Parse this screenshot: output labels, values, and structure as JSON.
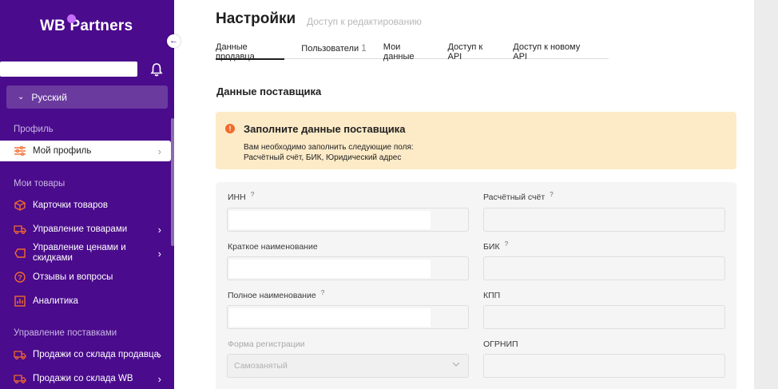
{
  "brand": {
    "logo": "WB Partners"
  },
  "header": {
    "collapse_icon": "arrow-left-icon",
    "bell_icon": "bell-icon",
    "language": "Русский"
  },
  "sidebar": {
    "profile_section": "Профиль",
    "profile_item": "Мой профиль",
    "goods_section": "Мои товары",
    "goods_items": [
      {
        "label": "Карточки товаров",
        "icon": "box-icon"
      },
      {
        "label": "Управление товарами",
        "icon": "truck-icon"
      },
      {
        "label": "Управление ценами и",
        "label2": "скидками",
        "icon": "tag-icon"
      },
      {
        "label": "Отзывы и вопросы",
        "icon": "question-icon"
      },
      {
        "label": "Аналитика",
        "icon": "chart-icon"
      }
    ],
    "supply_section": "Управление поставками",
    "supply_items": [
      {
        "label": "Продажи со склада продавца",
        "icon": "truck-icon"
      },
      {
        "label": "Продажи со склада WB",
        "icon": "truck-icon"
      }
    ]
  },
  "page": {
    "title": "Настройки",
    "subtitle": "Доступ к редактированию",
    "tabs": [
      {
        "label": "Данные продавца"
      },
      {
        "label": "Пользователи",
        "count": "1"
      },
      {
        "label": "Мои данные"
      },
      {
        "label": "Доступ к API"
      },
      {
        "label": "Доступ к новому API"
      }
    ],
    "section_title": "Данные поставщика",
    "alert": {
      "title": "Заполните данные поставщика",
      "line1": "Вам необходимо заполнить следующие поля:",
      "line2": "Расчётный счёт, БИК, Юридический адрес"
    },
    "form": {
      "inn": "ИНН",
      "account": "Расчётный счёт",
      "short_name": "Краткое наименование",
      "bik": "БИК",
      "full_name": "Полное наименование",
      "kpp": "КПП",
      "reg_form": "Форма регистрации",
      "reg_form_value": "Самозанятый",
      "ogrnip": "ОГРНИП",
      "help_mark": "?"
    }
  },
  "colors": {
    "sidebar_bg": "#4a0b8c",
    "alert_bg": "#fdebc8",
    "accent": "#f26a2b"
  }
}
